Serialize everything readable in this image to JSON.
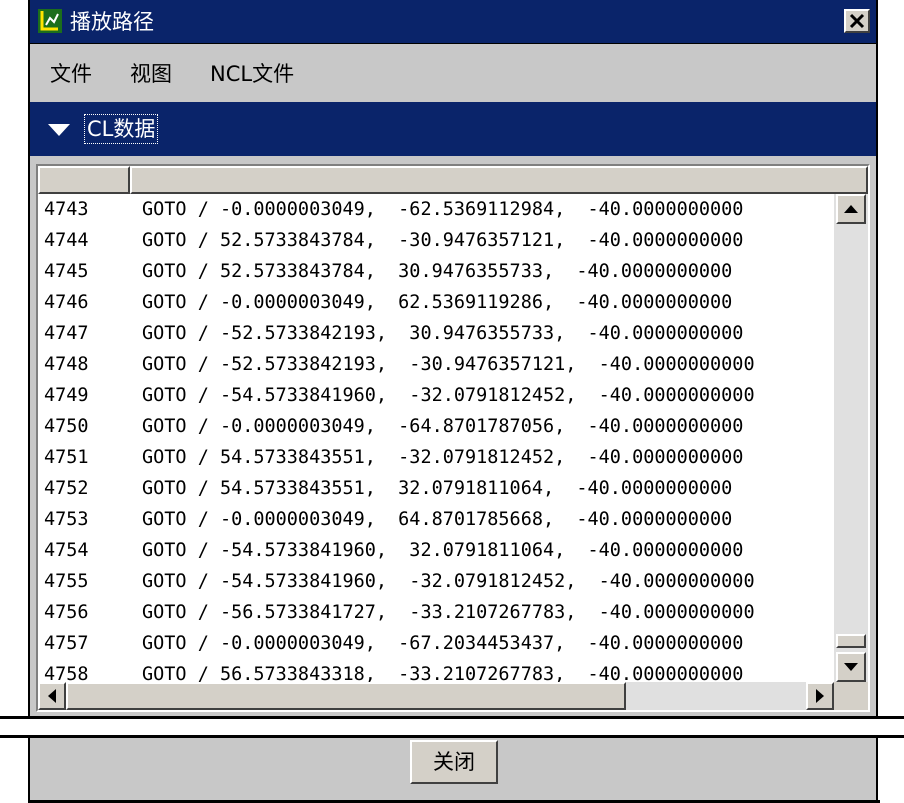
{
  "window": {
    "title": "播放路径"
  },
  "menu": {
    "items": [
      "文件",
      "视图",
      "NCL文件"
    ]
  },
  "section": {
    "label": "CL数据"
  },
  "list": {
    "rows": [
      {
        "num": "4743",
        "cmd": "GOTO / -0.0000003049,  -62.5369112984,  -40.0000000000"
      },
      {
        "num": "4744",
        "cmd": "GOTO / 52.5733843784,  -30.9476357121,  -40.0000000000"
      },
      {
        "num": "4745",
        "cmd": "GOTO / 52.5733843784,  30.9476355733,  -40.0000000000"
      },
      {
        "num": "4746",
        "cmd": "GOTO / -0.0000003049,  62.5369119286,  -40.0000000000"
      },
      {
        "num": "4747",
        "cmd": "GOTO / -52.5733842193,  30.9476355733,  -40.0000000000"
      },
      {
        "num": "4748",
        "cmd": "GOTO / -52.5733842193,  -30.9476357121,  -40.0000000000"
      },
      {
        "num": "4749",
        "cmd": "GOTO / -54.5733841960,  -32.0791812452,  -40.0000000000"
      },
      {
        "num": "4750",
        "cmd": "GOTO / -0.0000003049,  -64.8701787056,  -40.0000000000"
      },
      {
        "num": "4751",
        "cmd": "GOTO / 54.5733843551,  -32.0791812452,  -40.0000000000"
      },
      {
        "num": "4752",
        "cmd": "GOTO / 54.5733843551,  32.0791811064,  -40.0000000000"
      },
      {
        "num": "4753",
        "cmd": "GOTO / -0.0000003049,  64.8701785668,  -40.0000000000"
      },
      {
        "num": "4754",
        "cmd": "GOTO / -54.5733841960,  32.0791811064,  -40.0000000000"
      },
      {
        "num": "4755",
        "cmd": "GOTO / -54.5733841960,  -32.0791812452,  -40.0000000000"
      },
      {
        "num": "4756",
        "cmd": "GOTO / -56.5733841727,  -33.2107267783,  -40.0000000000"
      },
      {
        "num": "4757",
        "cmd": "GOTO / -0.0000003049,  -67.2034453437,  -40.0000000000"
      },
      {
        "num": "4758",
        "cmd": "GOTO / 56.5733843318,  -33.2107267783,  -40.0000000000"
      }
    ]
  },
  "footer": {
    "close_label": "关闭"
  },
  "icons": {
    "title": "app-icon",
    "close": "close-x-icon",
    "collapse": "triangle-down-icon",
    "up": "arrow-up-icon",
    "down": "arrow-down-icon",
    "left": "arrow-left-icon",
    "right": "arrow-right-icon"
  },
  "colors": {
    "titlebar": "#0a246a",
    "panel": "#c8c8c8"
  }
}
